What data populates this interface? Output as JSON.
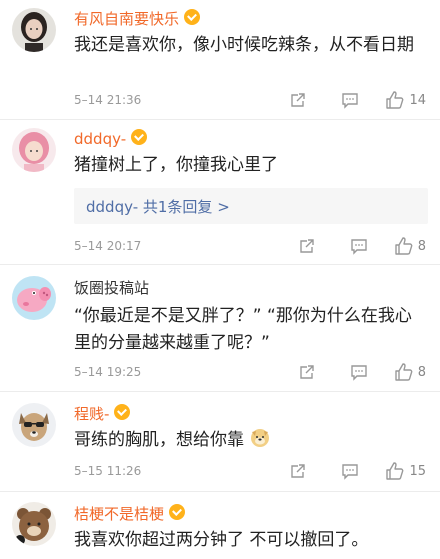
{
  "comments": [
    {
      "username": "有风自南要快乐",
      "name_style": "orange",
      "vip": true,
      "avatar": "woman-portrait-avatar",
      "text": "我还是喜欢你，像小时候吃辣条，从不看日期",
      "time": "5–14 21:36",
      "likes": "14"
    },
    {
      "username": "dddqy-",
      "name_style": "orange",
      "vip": true,
      "avatar": "pink-hair-girl-avatar",
      "text": "猪撞树上了，你撞我心里了",
      "reply": "dddqy- 共1条回复 >",
      "time": "5–14 20:17",
      "likes": "8"
    },
    {
      "username": "饭圈投稿站",
      "name_style": "plain",
      "vip": false,
      "avatar": "peppa-pig-avatar",
      "text": "“你最近是不是又胖了？” “那你为什么在我心里的分量越来越重了呢？”",
      "time": "5–14 19:25",
      "likes": "8"
    },
    {
      "username": "程贱-",
      "name_style": "orange",
      "vip": true,
      "avatar": "dog-with-glasses-avatar",
      "text": "哥练的胸肌，想给你靠",
      "emoji": "doge-emoji",
      "time": "5–15 11:26",
      "likes": "15"
    },
    {
      "username": "桔梗不是桔梗",
      "name_style": "orange",
      "vip": true,
      "avatar": "cartoon-bear-avatar",
      "text": "我喜欢你超过两分钟了 不可以撤回了。"
    }
  ],
  "colors": {
    "vip_name": "#f1692a",
    "reply_link": "#506ea6",
    "meta_gray": "#9a9a9a",
    "vip_badge": "#ffb21a"
  }
}
